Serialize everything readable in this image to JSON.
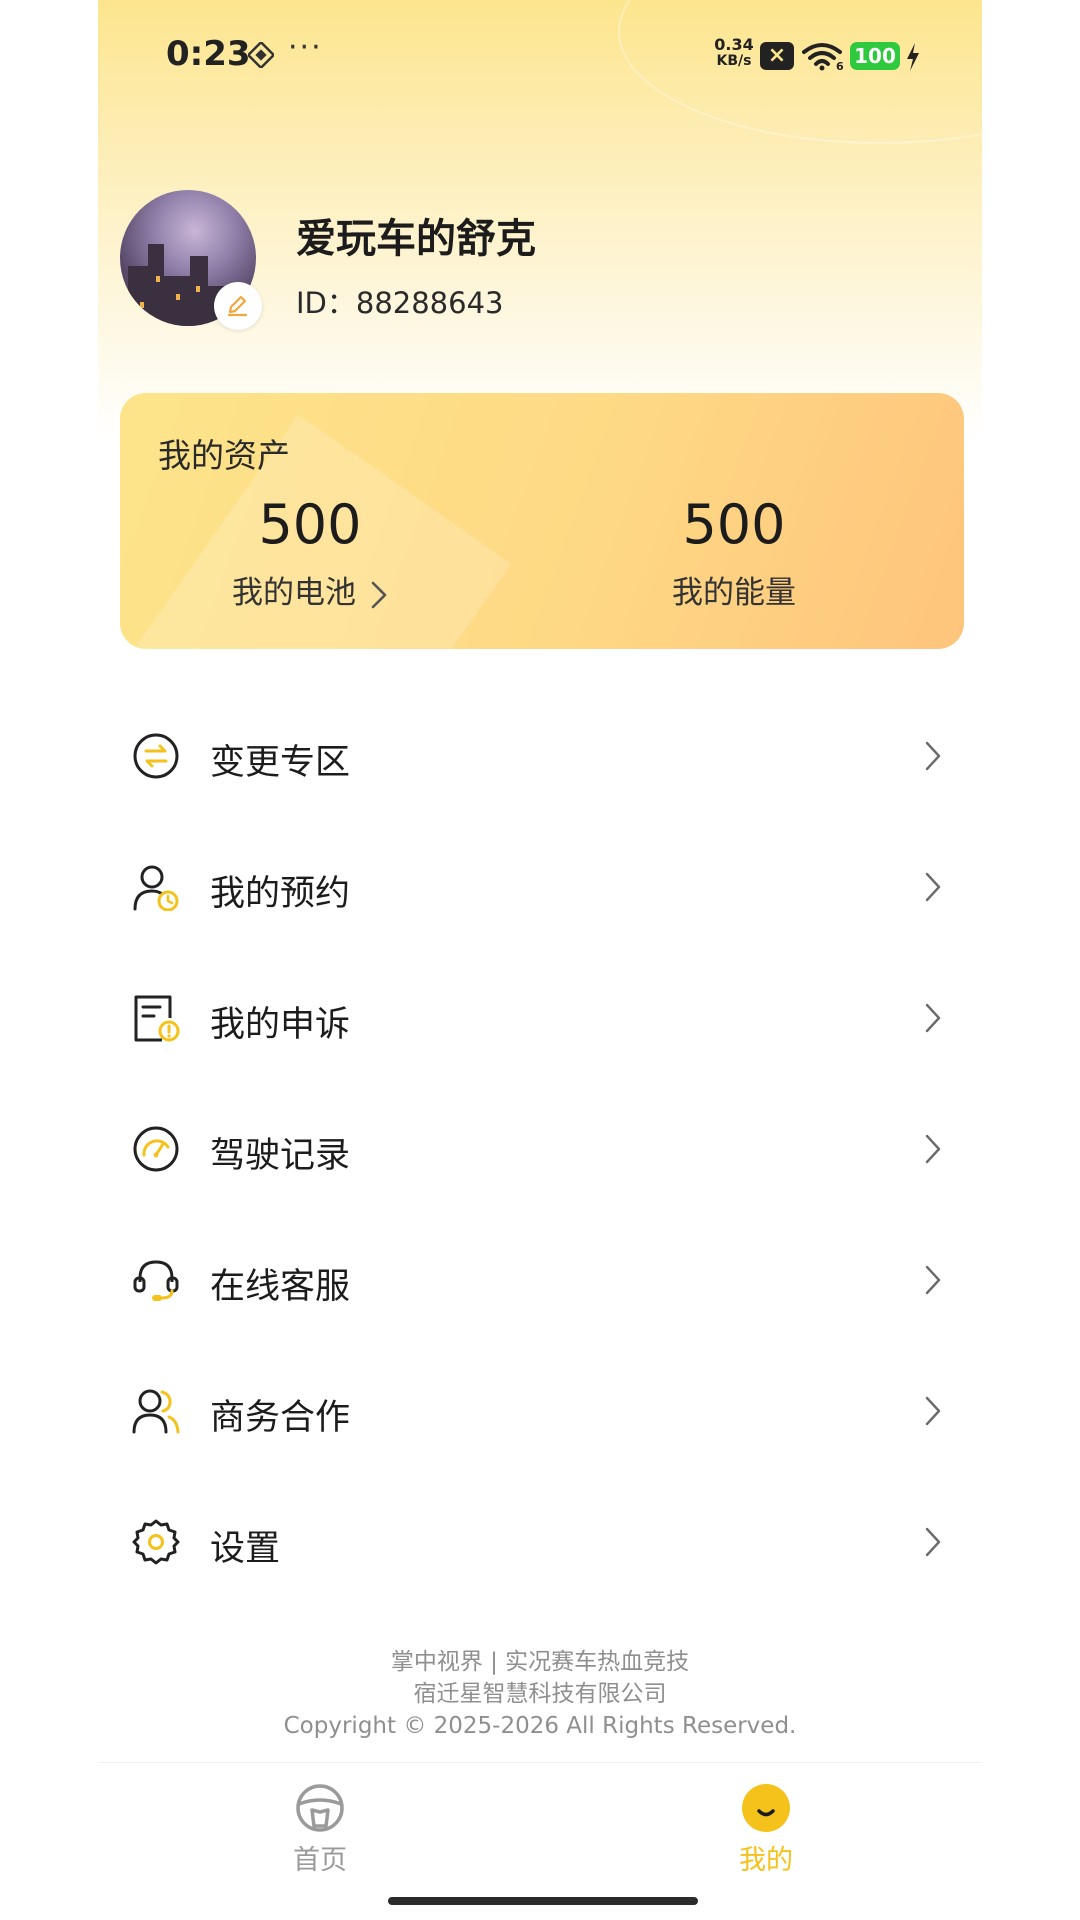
{
  "status_bar": {
    "time": "0:23",
    "dots": "···",
    "net_speed_value": "0.34",
    "net_speed_unit": "KB/s",
    "wifi_badge": "6",
    "battery": "100",
    "colors": {
      "battery": "#2fc93e"
    }
  },
  "profile": {
    "username": "爱玩车的舒克",
    "id_text": "ID：88288643"
  },
  "assets": {
    "title": "我的资产",
    "battery": {
      "value": "500",
      "label": "我的电池"
    },
    "energy": {
      "value": "500",
      "label": "我的能量"
    }
  },
  "menu": {
    "items": [
      {
        "label": "变更专区",
        "icon": "exchange-icon"
      },
      {
        "label": "我的预约",
        "icon": "user-clock-icon"
      },
      {
        "label": "我的申诉",
        "icon": "complaint-doc-icon"
      },
      {
        "label": "驾驶记录",
        "icon": "speedometer-icon"
      },
      {
        "label": "在线客服",
        "icon": "headset-icon"
      },
      {
        "label": "商务合作",
        "icon": "partners-icon"
      },
      {
        "label": "设置",
        "icon": "gear-icon"
      }
    ]
  },
  "footer": {
    "line1": "掌中视界 | 实况赛车热血竞技",
    "line2": "宿迁星智慧科技有限公司",
    "line3": "Copyright © 2025-2026 All Rights Reserved."
  },
  "tabbar": {
    "home": {
      "label": "首页",
      "icon": "steering-wheel-icon"
    },
    "mine": {
      "label": "我的",
      "icon": "smiley-icon",
      "active": true
    }
  },
  "colors": {
    "accent": "#f5c21b",
    "card_start": "#fde48a",
    "card_end": "#fec47c",
    "header": "#fde58e"
  }
}
